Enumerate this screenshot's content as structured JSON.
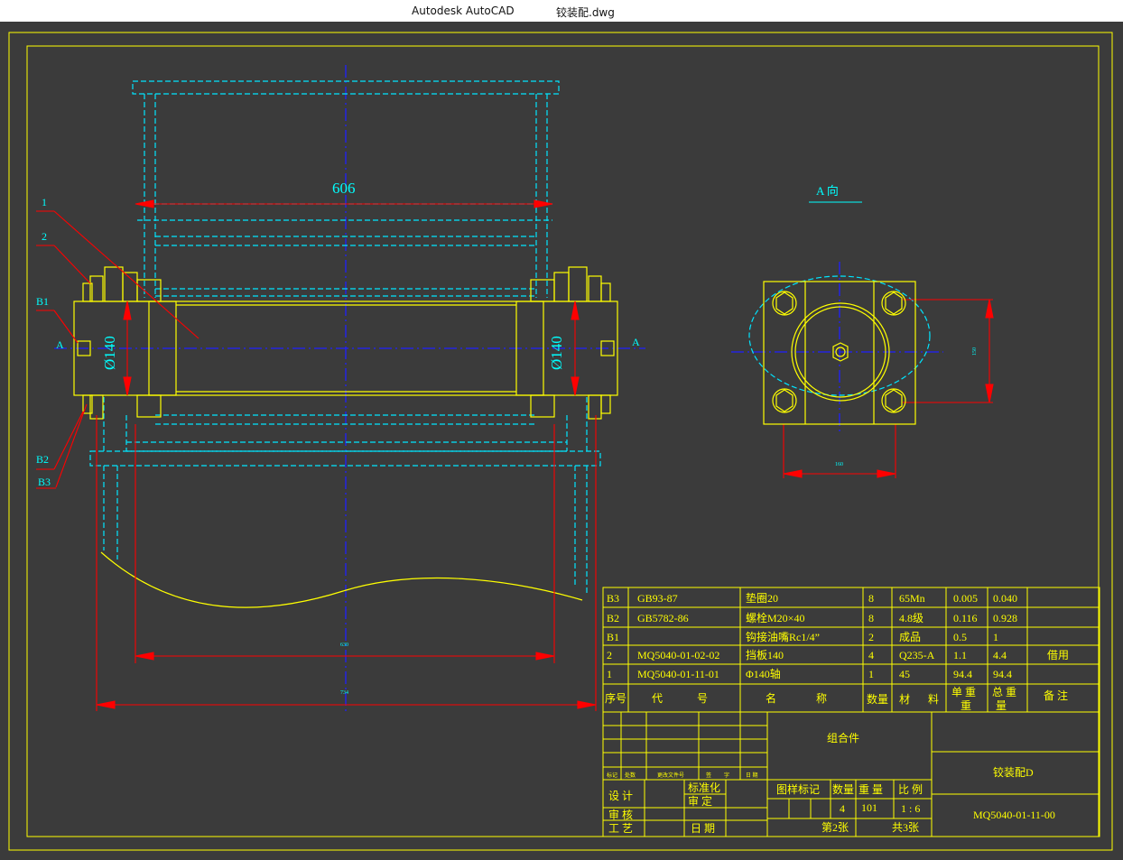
{
  "window": {
    "app": "Autodesk AutoCAD",
    "file": "铰装配.dwg"
  },
  "drawing": {
    "dim_width": "606",
    "dim_dia_left": "Ø140",
    "dim_dia_right": "Ø140",
    "dim_small_630": "630",
    "dim_small_734": "734",
    "dim_small_150": "150",
    "dim_small_160": "160",
    "view_label": "A 向",
    "section_left": "A",
    "section_right": "A",
    "callouts": [
      "1",
      "2",
      "B1",
      "B2",
      "B3"
    ]
  },
  "bom": {
    "rows": [
      [
        "B3",
        "GB93-87",
        "垫圈20",
        "8",
        "65Mn",
        "0.005",
        "0.040",
        ""
      ],
      [
        "B2",
        "GB5782-86",
        "螺栓M20×40",
        "8",
        "4.8级",
        "0.116",
        "0.928",
        ""
      ],
      [
        "B1",
        "",
        "钩接油嘴Rc1/4”",
        "2",
        "成品",
        "0.5",
        "1",
        ""
      ],
      [
        "2",
        "MQ5040-01-02-02",
        "挡板140",
        "4",
        "Q235-A",
        "1.1",
        "4.4",
        "借用"
      ],
      [
        "1",
        "MQ5040-01-11-01",
        "Φ140轴",
        "1",
        "45",
        "94.4",
        "94.4",
        ""
      ]
    ],
    "header": {
      "seq": "序号",
      "code_a": "代",
      "code_b": "号",
      "name_a": "名",
      "name_b": "称",
      "qty": "数量",
      "mat_a": "材",
      "mat_b": "料",
      "unit_a": "单 重",
      "unit_b": "重",
      "total_a": "总 重",
      "total_b": "量",
      "remark": "备 注"
    }
  },
  "titleblock": {
    "rev_labels": [
      "标记",
      "处数",
      "更改文件号",
      "签",
      "字",
      "日 期"
    ],
    "design": "设 计",
    "check": "审 核",
    "process": "工 艺",
    "standard": "标准化",
    "review": "审 定",
    "date": "日 期",
    "assembly": "组合件",
    "part_name": "铰装配D",
    "drawing_no": "MQ5040-01-11-00",
    "sample_mark": "图样标记",
    "quantity_label": "数量",
    "weight_label": "重 量",
    "scale_label": "比 例",
    "quantity": "4",
    "weight": "101",
    "scale": "1 : 6",
    "sheet": "第2张",
    "total_sheets": "共3张"
  },
  "colors": {
    "bg": "#3b3b3b",
    "yellow": "#ffff00",
    "cyan": "#00ffff",
    "red": "#ff0000",
    "blue": "#0000ff"
  }
}
